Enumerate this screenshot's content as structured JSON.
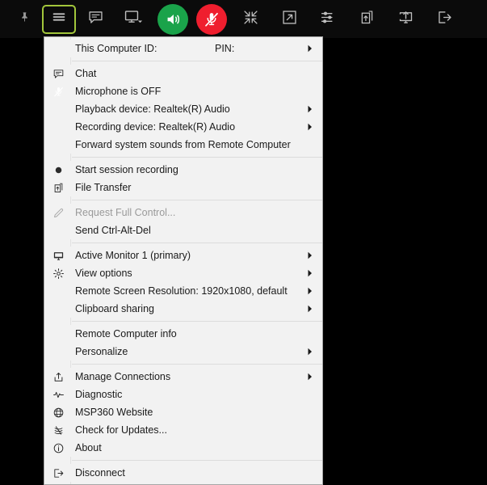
{
  "window": {
    "background_color": "#000000",
    "toolbar_background": "#0b0b0b",
    "menu_background": "#f2f2f2",
    "accent_highlight": "#a2c63b",
    "speaker_on_color": "#1aa34a",
    "mic_off_color": "#ef1e2e"
  },
  "toolbar": {
    "items": [
      {
        "name": "pin-toolbar-button",
        "icon": "pushpin-icon",
        "label": "Pin toolbar",
        "active": false
      },
      {
        "name": "main-menu-button",
        "icon": "hamburger-menu-icon",
        "label": "Menu",
        "active": true
      },
      {
        "name": "chat-button",
        "icon": "chat-bubble-icon",
        "label": "Chat",
        "active": false
      },
      {
        "name": "monitor-select-button",
        "icon": "monitor-dropdown-icon",
        "label": "Select monitor",
        "active": false
      },
      {
        "name": "speaker-toggle-button",
        "icon": "speaker-on-icon",
        "label": "Sound on",
        "active": false
      },
      {
        "name": "microphone-toggle-button",
        "icon": "microphone-muted-icon",
        "label": "Microphone is OFF",
        "active": false
      },
      {
        "name": "fit-to-screen-button",
        "icon": "shrink-arrows-icon",
        "label": "Fit to screen",
        "active": false
      },
      {
        "name": "fullscreen-button",
        "icon": "expand-arrow-box-icon",
        "label": "Full screen",
        "active": false
      },
      {
        "name": "settings-sliders-button",
        "icon": "sliders-icon",
        "label": "Settings",
        "active": false
      },
      {
        "name": "file-transfer-button",
        "icon": "file-upload-icon",
        "label": "File transfer",
        "active": false
      },
      {
        "name": "share-screen-button",
        "icon": "monitor-upload-icon",
        "label": "Share",
        "active": false
      },
      {
        "name": "disconnect-button",
        "icon": "exit-arrow-icon",
        "label": "Disconnect",
        "active": false
      }
    ]
  },
  "menu": {
    "groups": [
      {
        "name": "identity-group",
        "items": [
          {
            "name": "this-computer-id",
            "label": "This Computer ID:",
            "secondary": "PIN:",
            "icon": null,
            "arrow": true,
            "disabled": false
          }
        ]
      },
      {
        "name": "communication-group",
        "items": [
          {
            "name": "chat",
            "label": "Chat",
            "icon": "chat-bubble-icon",
            "arrow": false,
            "disabled": false
          },
          {
            "name": "microphone-state",
            "label": "Microphone is OFF",
            "icon": "microphone-muted-icon",
            "arrow": false,
            "disabled": false
          },
          {
            "name": "playback-device",
            "label": "Playback device: Realtek(R) Audio",
            "icon": null,
            "arrow": true,
            "disabled": false
          },
          {
            "name": "recording-device",
            "label": "Recording device: Realtek(R) Audio",
            "icon": null,
            "arrow": true,
            "disabled": false
          },
          {
            "name": "forward-system-sounds",
            "label": "Forward system sounds from Remote Computer",
            "icon": null,
            "arrow": false,
            "disabled": false
          }
        ]
      },
      {
        "name": "session-tools-group",
        "items": [
          {
            "name": "start-session-recording",
            "label": "Start session recording",
            "icon": "record-dot-icon",
            "arrow": false,
            "disabled": false
          },
          {
            "name": "file-transfer",
            "label": "File Transfer",
            "icon": "file-upload-icon",
            "arrow": false,
            "disabled": false
          }
        ]
      },
      {
        "name": "control-group",
        "items": [
          {
            "name": "request-full-control",
            "label": "Request Full Control...",
            "icon": "pencil-icon",
            "arrow": false,
            "disabled": true
          },
          {
            "name": "send-ctrl-alt-del",
            "label": "Send Ctrl-Alt-Del",
            "icon": null,
            "arrow": false,
            "disabled": false
          }
        ]
      },
      {
        "name": "display-group",
        "items": [
          {
            "name": "active-monitor",
            "label": "Active Monitor 1 (primary)",
            "icon": "monitor-icon",
            "arrow": true,
            "disabled": false
          },
          {
            "name": "view-options",
            "label": "View options",
            "icon": "gear-icon",
            "arrow": true,
            "disabled": false
          },
          {
            "name": "remote-screen-resolution",
            "label": "Remote Screen Resolution: 1920x1080, default",
            "icon": null,
            "arrow": true,
            "disabled": false
          },
          {
            "name": "clipboard-sharing",
            "label": "Clipboard sharing",
            "icon": null,
            "arrow": true,
            "disabled": false
          }
        ]
      },
      {
        "name": "info-group",
        "items": [
          {
            "name": "remote-computer-info",
            "label": "Remote Computer info",
            "icon": null,
            "arrow": false,
            "disabled": false
          },
          {
            "name": "personalize",
            "label": "Personalize",
            "icon": null,
            "arrow": true,
            "disabled": false
          }
        ]
      },
      {
        "name": "app-group",
        "items": [
          {
            "name": "manage-connections",
            "label": "Manage Connections",
            "icon": "upload-box-icon",
            "arrow": true,
            "disabled": false
          },
          {
            "name": "diagnostic",
            "label": "Diagnostic",
            "icon": "pulse-icon",
            "arrow": false,
            "disabled": false
          },
          {
            "name": "msp360-website",
            "label": "MSP360 Website",
            "icon": "globe-icon",
            "arrow": false,
            "disabled": false
          },
          {
            "name": "check-for-updates",
            "label": "Check for Updates...",
            "icon": "refresh-icon",
            "arrow": false,
            "disabled": false
          },
          {
            "name": "about",
            "label": "About",
            "icon": "info-circle-icon",
            "arrow": false,
            "disabled": false
          }
        ]
      },
      {
        "name": "disconnect-group",
        "items": [
          {
            "name": "disconnect",
            "label": "Disconnect",
            "icon": "exit-arrow-icon",
            "arrow": false,
            "disabled": false
          }
        ]
      }
    ]
  }
}
